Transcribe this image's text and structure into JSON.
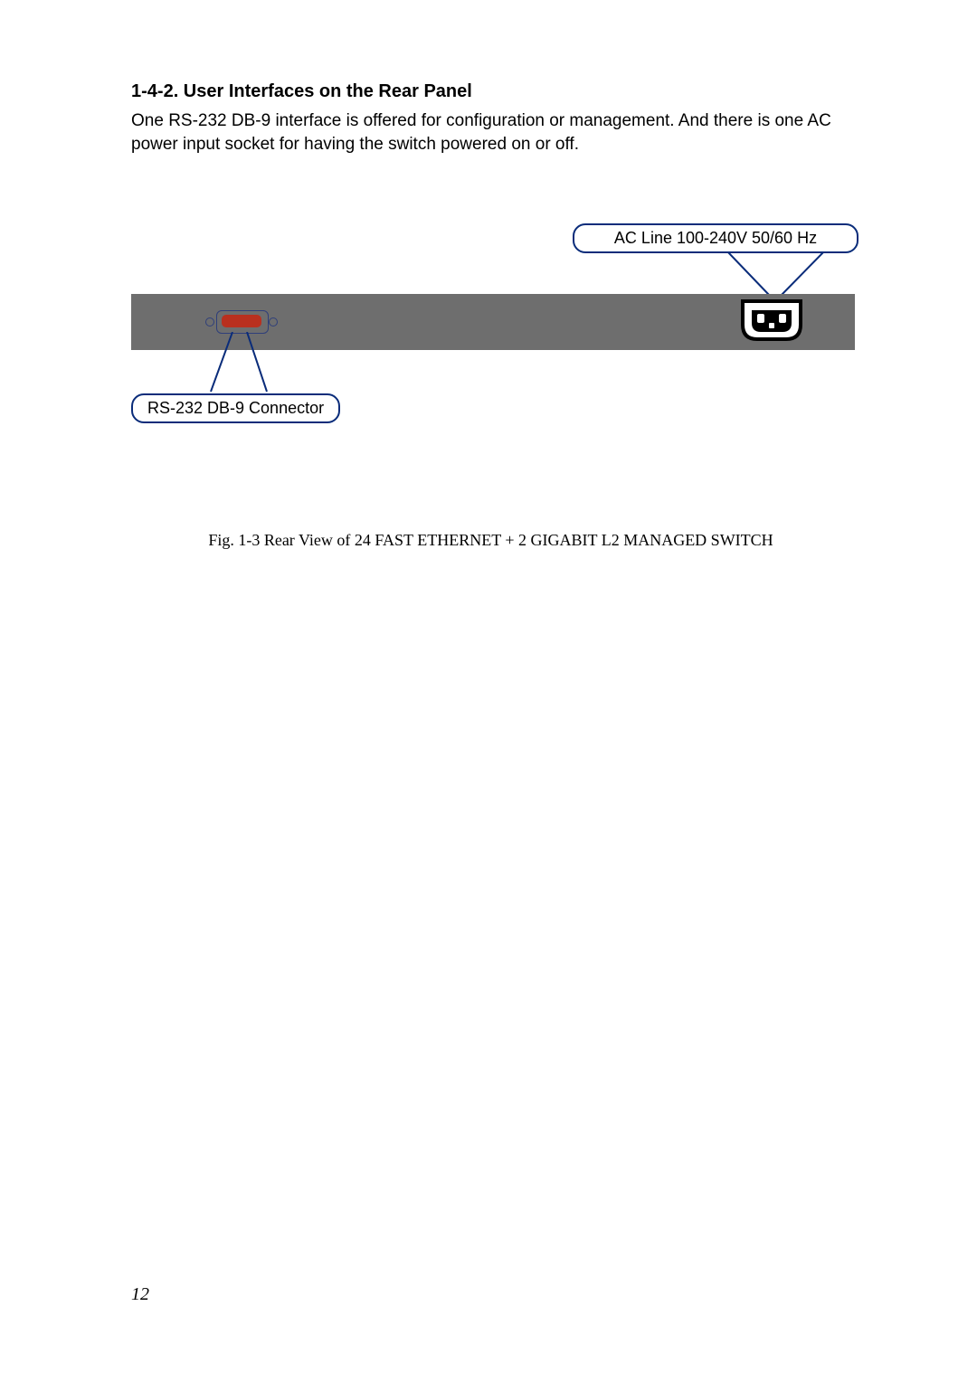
{
  "heading": "1-4-2. User Interfaces on the Rear Panel",
  "body_text": "One RS-232 DB-9 interface is offered for configuration or management. And there is one AC power input socket for having the switch powered on or off.",
  "labels": {
    "ac": "AC Line 100-240V 50/60 Hz",
    "rs": "RS-232 DB-9 Connector"
  },
  "caption": "Fig. 1-3 Rear View of 24 FAST ETHERNET + 2 GIGABIT L2 MANAGED SWITCH",
  "page_number": "12"
}
